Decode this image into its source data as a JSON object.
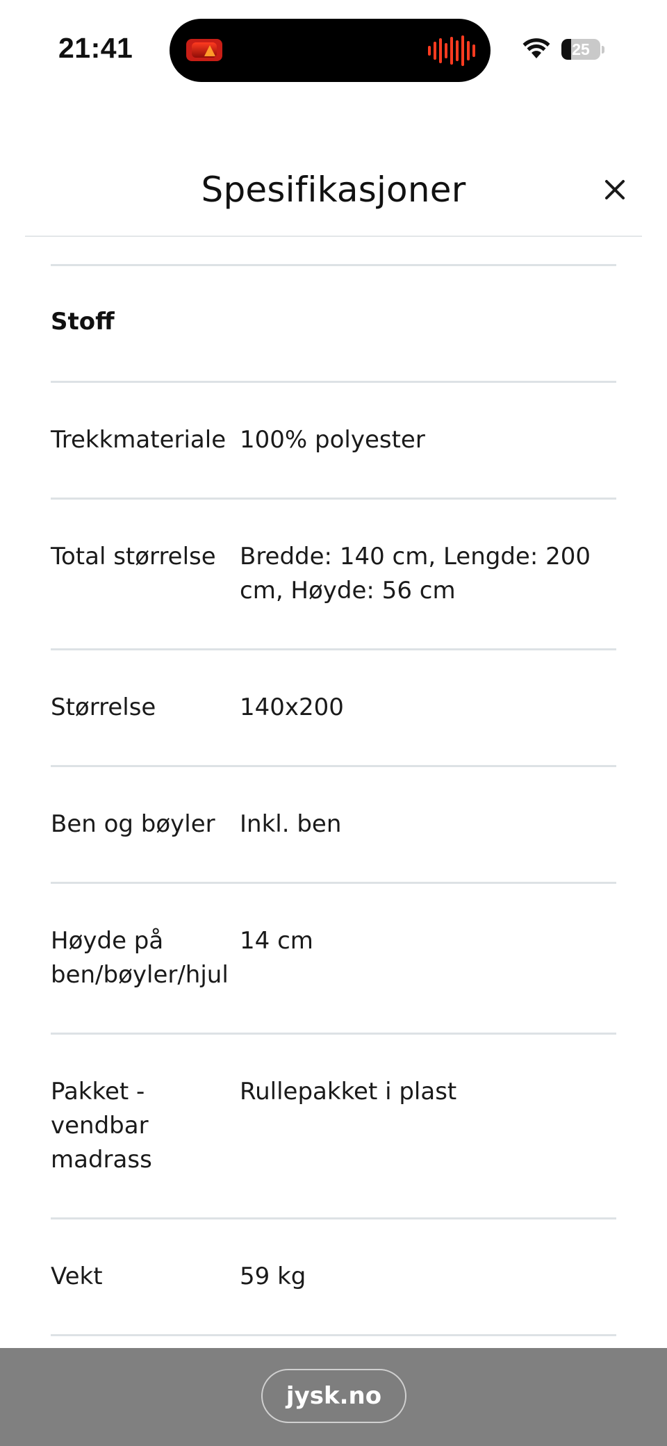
{
  "status_bar": {
    "time": "21:41",
    "battery_level": "25",
    "island_app_icon": "app-icon",
    "island_activity_icon": "waveform-icon",
    "wifi_icon": "wifi-icon",
    "battery_icon": "battery-icon"
  },
  "header": {
    "title": "Spesifikasjoner",
    "close_icon": "close-icon"
  },
  "specs": {
    "section_title": "Stoff",
    "rows": [
      {
        "label": "Trekkmateriale",
        "value": "100% polyester"
      },
      {
        "label": "Total størrelse",
        "value": "Bredde: 140 cm, Lengde: 200 cm, Høyde: 56 cm"
      },
      {
        "label": "Størrelse",
        "value": "140x200"
      },
      {
        "label": "Ben og bøyler",
        "value": "Inkl. ben"
      },
      {
        "label": "Høyde på ben/bøyler/hjul",
        "value": "14 cm"
      },
      {
        "label": "Pakket - vendbar madrass",
        "value": "Rullepakket i plast"
      },
      {
        "label": "Vekt",
        "value": "59 kg"
      }
    ]
  },
  "browser": {
    "url": "jysk.no"
  },
  "colors": {
    "divider": "#dde2e5",
    "url_bar": "#808080",
    "island_accent": "#ff3b20"
  }
}
